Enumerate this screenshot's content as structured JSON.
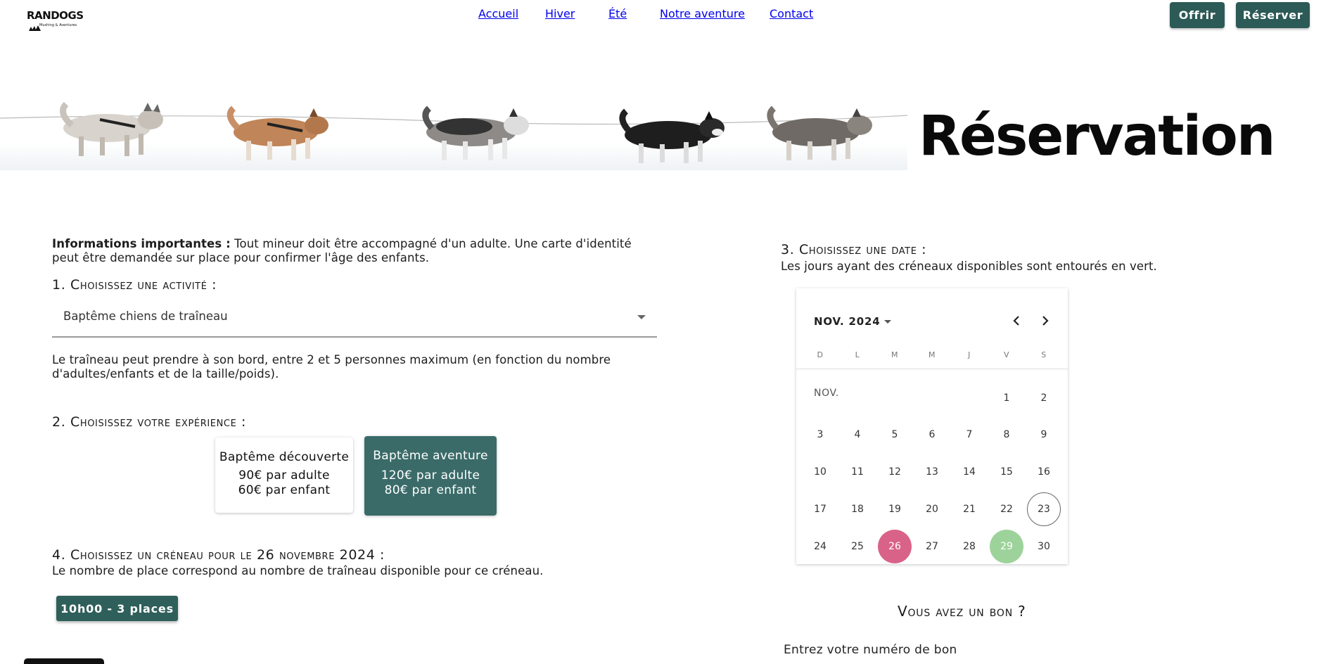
{
  "header": {
    "logo_text": "RANDOGS",
    "logo_subtext": "Mushing & Aventures",
    "nav": [
      {
        "label": "Accueil"
      },
      {
        "label": "Hiver"
      },
      {
        "label": "Été"
      },
      {
        "label": "Notre aventure"
      },
      {
        "label": "Contact"
      }
    ],
    "buttons": {
      "offer": "Offrir",
      "book": "Réserver"
    }
  },
  "hero": {
    "title": "Réservation"
  },
  "info": {
    "label": "Informations importantes :",
    "text": " Tout mineur doit être accompagné d'un adulte. Une carte d'identité peut être demandée sur place pour confirmer l'âge des enfants."
  },
  "step1": {
    "heading": "1. Choisissez une activité :",
    "selected": "Baptême chiens de traîneau",
    "note": "Le traîneau peut prendre à son bord, entre 2 et 5 personnes maximum (en fonction du nombre d'adultes/enfants et de la taille/poids)."
  },
  "step2": {
    "heading": "2. Choisissez votre expérience :",
    "options": [
      {
        "title": "Baptême découverte",
        "adult": "90€ par adulte",
        "child": "60€ par enfant"
      },
      {
        "title": "Baptême aventure",
        "adult": "120€ par adulte",
        "child": "80€ par enfant"
      }
    ],
    "selected_index": 1
  },
  "step3": {
    "heading": "3. Choisissez une date :",
    "subtitle": "Les jours ayant des créneaux disponibles sont entourés en vert.",
    "calendar": {
      "month_label": "NOV. 2024",
      "period_label": "NOV.",
      "weekdays": [
        "D",
        "L",
        "M",
        "M",
        "J",
        "V",
        "S"
      ],
      "first_weekday_index": 5,
      "days_in_month": 30,
      "today": 23,
      "selected": 26,
      "available": [
        29
      ],
      "colors": {
        "selected": "#d96388",
        "available": "#9dd39a"
      }
    }
  },
  "step4": {
    "heading": "4. Choisissez un créneau pour le 26 novembre 2024 :",
    "subtitle": "Le nombre de place correspond au nombre de traîneau disponible pour ce créneau.",
    "slots": [
      "10h00 - 3 places"
    ]
  },
  "voucher": {
    "heading": "Vous avez un bon ?",
    "label": "Entrez votre numéro de bon"
  },
  "colors": {
    "primary": "#2c5a56",
    "card_selected": "#3a6b68",
    "selected_day": "#d96388",
    "available_day": "#9dd39a"
  }
}
